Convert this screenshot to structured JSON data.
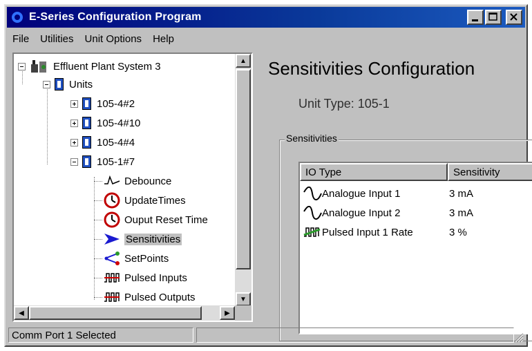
{
  "window": {
    "title": "E-Series Configuration Program"
  },
  "menu": [
    "File",
    "Utilities",
    "Unit Options",
    "Help"
  ],
  "tree": {
    "root": "Effluent Plant System 3",
    "units": "Units",
    "unit_items": [
      "105-4#2",
      "105-4#10",
      "105-4#4",
      "105-1#7"
    ],
    "children": [
      "Debounce",
      "UpdateTimes",
      "Ouput Reset Time",
      "Sensitivities",
      "SetPoints",
      "Pulsed Inputs",
      "Pulsed Outputs"
    ]
  },
  "panel": {
    "title": "Sensitivities Configuration",
    "unit_type": "Unit Type: 105-1",
    "group_label": "Sensitivities",
    "columns": [
      "IO Type",
      "Sensitivity"
    ],
    "rows": [
      {
        "type": "Analogue Input 1",
        "sensitivity": "3 mA"
      },
      {
        "type": "Analogue Input 2",
        "sensitivity": "3 mA"
      },
      {
        "type": "Pulsed Input 1 Rate",
        "sensitivity": "3 %"
      }
    ]
  },
  "status": {
    "text": "Comm Port 1 Selected",
    "second": ""
  }
}
